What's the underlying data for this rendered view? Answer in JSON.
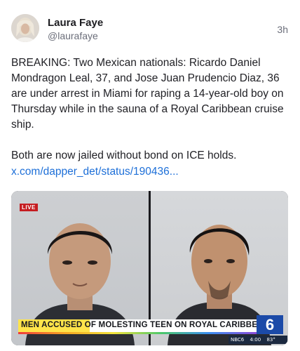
{
  "author": {
    "name": "Laura Faye",
    "handle": "@laurafaye",
    "avatar_icon": "profile-photo"
  },
  "post": {
    "timestamp": "3h",
    "paragraph_1": "BREAKING: Two Mexican nationals: Ricardo Daniel Mondragon Leal, 37, and Jose Juan Prudencio Diaz, 36 are under arrest in Miami for raping a 14-year-old boy on Thursday while in the sauna of a Royal Caribbean cruise ship.",
    "paragraph_2": "Both are now jailed without bond on ICE holds.",
    "link_text": "x.com/dapper_det/status/190436..."
  },
  "media": {
    "live_label": "LIVE",
    "headline": "MEN ACCUSED OF MOLESTING TEEN ON ROYAL CARIBBEAN SHIP",
    "station_logo": "6",
    "ticker_station": "NBC6",
    "ticker_time": "4:00",
    "ticker_temp": "83°",
    "colors": {
      "live_badge": "#c51d21",
      "headline_highlight": "#ffe44a",
      "station_blue": "#1b4aa8"
    }
  }
}
